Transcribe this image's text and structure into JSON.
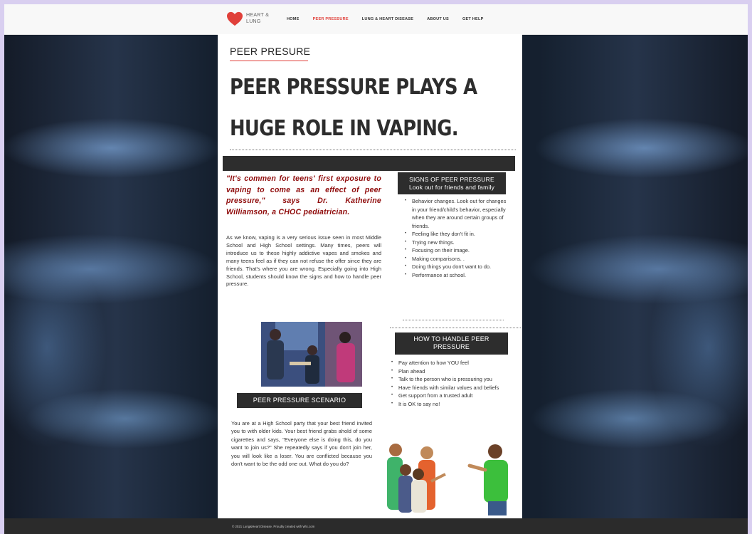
{
  "brand": {
    "name_line1": "HEART &",
    "name_line2": "LUNG",
    "accent": "#e0403a"
  },
  "nav": {
    "items": [
      {
        "label": "HOME",
        "active": false
      },
      {
        "label": "PEER PRESSURE",
        "active": true
      },
      {
        "label": "LUNG & HEART DISEASE",
        "active": false
      },
      {
        "label": "ABOUT US",
        "active": false
      },
      {
        "label": "GET HELP",
        "active": false
      }
    ]
  },
  "page": {
    "kicker": "PEER PRESURE",
    "headline": "PEER PRESSURE PLAYS A HUGE ROLE IN VAPING.",
    "quote": "\"It's commen for teens' first exposure to vaping to come as an effect of peer pressure,\" says Dr. Katherine Williamson, a CHOC pediatrician.",
    "intro": "As we know, vaping is a very serious issue seen in most Middle School and High School settings. Many times, peers will introduce us to these highly addictive vapes and smokes and many teens feel as if they can not refuse the offer since they are friends. That's where you are wrong. Especially going into High School, students should know the signs and how to handle peer pressure.",
    "scenario_title": "PEER PRESSURE SCENARIO",
    "scenario": "You are at a High School party that your best friend invited you to with older kids. Your best friend grabs ahold of some cigarettes and says, \"Everyone else is doing this, do you want to join us?\" She repeatedly says if you don't join her, you will look like a loser. You are conflicted because you don't want to be the odd one out. What do you do?",
    "signs_title": "SIGNS OF PEER PRESSURE",
    "signs_subtitle": "Look out for friends and family",
    "signs": [
      "Behavior changes. Look out for changes in your friend/child's behavior, especially when they are around certain groups of friends.",
      "Feeling like they don't fit in.",
      "Trying new things.",
      "Focusing on their image.",
      "Making comparisons. .",
      "Doing things you don't want to do.",
      "Performance at school."
    ],
    "handle_title": "HOW TO HANDLE PEER PRESSURE",
    "handle": [
      "Pay attention to how YOU feel",
      "Plan ahead",
      "Talk to the person who is pressuring you",
      "Have friends with similar values and beliefs",
      "Get support from a trusted adult",
      "It is OK to say no!"
    ]
  },
  "footer": {
    "text": "© 2021 Lung&Heart Disease. Proudly created with Wix.com"
  }
}
